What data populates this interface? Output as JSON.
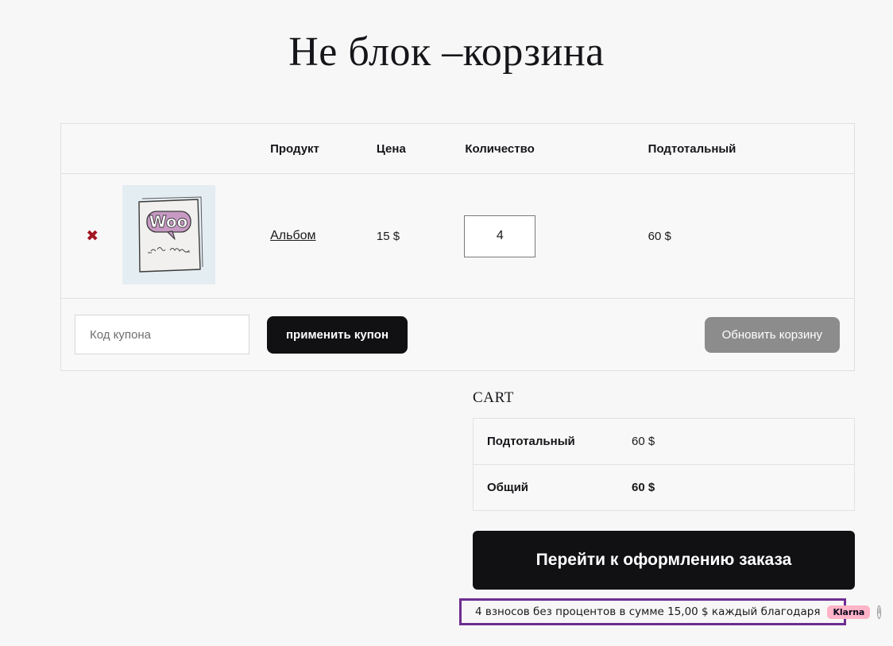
{
  "page": {
    "title": "Не блок –корзина",
    "background_color": "#f7f7f7"
  },
  "cart_table": {
    "headers": {
      "remove": "",
      "thumbnail": "",
      "product": "Продукт",
      "price": "Цена",
      "quantity": "Количество",
      "subtotal": "Подтотальный"
    },
    "rows": [
      {
        "remove_icon": "remove-x-icon",
        "remove_glyph": "✖",
        "thumbnail_alt": "woo-album-thumbnail",
        "product_name": "Альбом",
        "price": "15 $",
        "quantity": "4",
        "subtotal": "60 $"
      }
    ]
  },
  "coupon": {
    "placeholder": "Код купона",
    "value": "",
    "apply_label": "применить купон",
    "update_cart_label": "Обновить корзину"
  },
  "totals": {
    "heading": "CART",
    "rows": [
      {
        "label": "Подтотальный",
        "value": "60 $"
      },
      {
        "label": "Общий",
        "value": "60 $"
      }
    ],
    "checkout_label": "Перейти к оформлению заказа"
  },
  "klarna": {
    "message": "4 взносов без процентов в сумме 15,00 $ каждый благодаря",
    "badge": "Klarna",
    "info_glyph": "i",
    "border_color": "#6e2d91",
    "badge_color": "#ffb3c7"
  }
}
